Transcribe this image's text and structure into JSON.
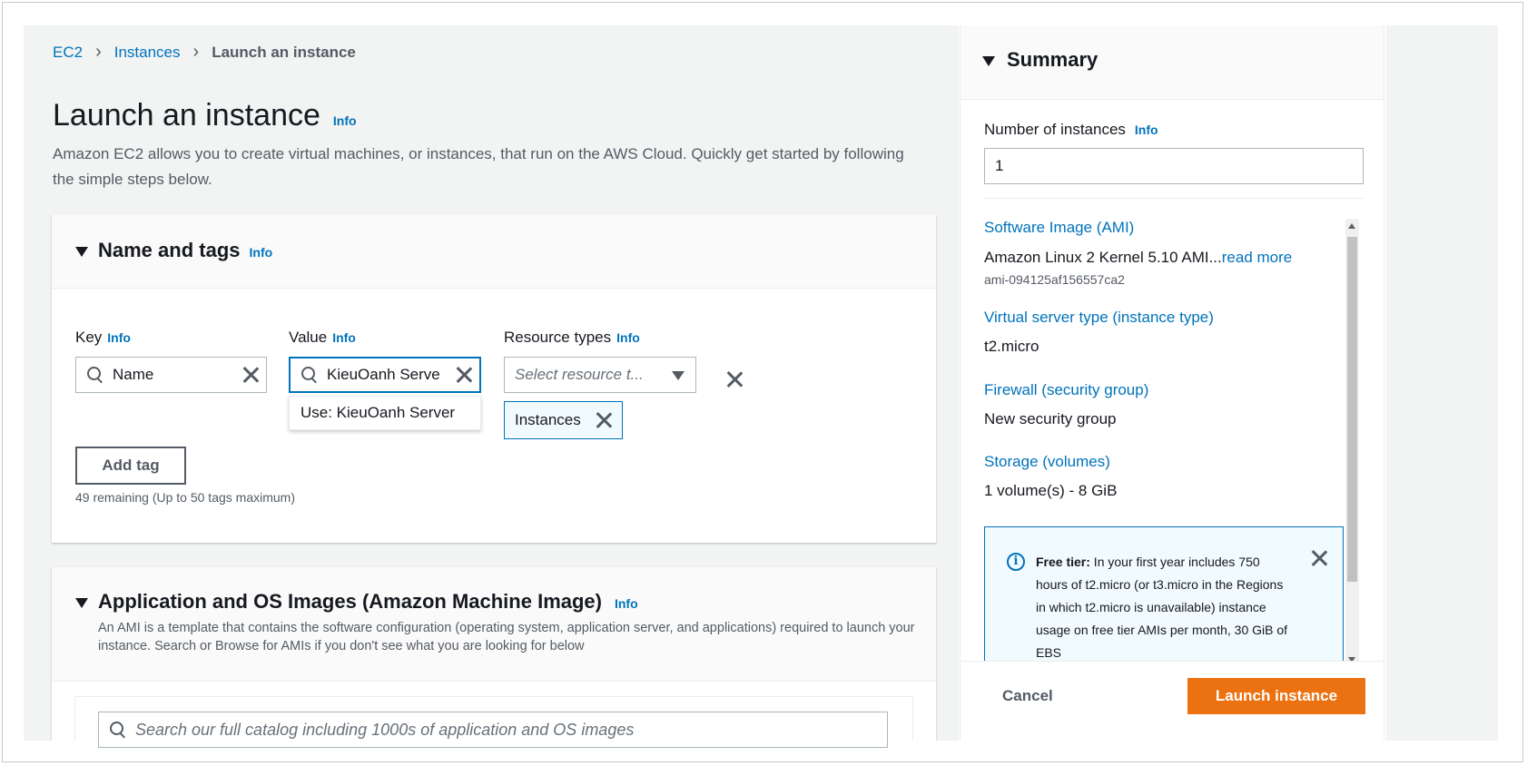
{
  "breadcrumb": {
    "items": [
      "EC2",
      "Instances"
    ],
    "current": "Launch an instance"
  },
  "page": {
    "title": "Launch an instance",
    "info": "Info",
    "description": "Amazon EC2 allows you to create virtual machines, or instances, that run on the AWS Cloud. Quickly get started by following the simple steps below."
  },
  "name_tags": {
    "title": "Name and tags",
    "info": "Info",
    "key_label": "Key",
    "value_label": "Value",
    "resource_label": "Resource types",
    "key_value": "Name",
    "value_value": "KieuOanh Serve",
    "resource_placeholder": "Select resource t...",
    "suggestion": "Use: KieuOanh Server",
    "token": "Instances",
    "add_tag": "Add tag",
    "remaining": "49 remaining (Up to 50 tags maximum)"
  },
  "ami": {
    "title": "Application and OS Images (Amazon Machine Image)",
    "info": "Info",
    "description": "An AMI is a template that contains the software configuration (operating system, application server, and applications) required to launch your instance. Search or Browse for AMIs if you don't see what you are looking for below",
    "search_placeholder": "Search our full catalog including 1000s of application and OS images"
  },
  "summary": {
    "title": "Summary",
    "num_label": "Number of instances",
    "info": "Info",
    "num_value": "1",
    "ami_link": "Software Image (AMI)",
    "ami_value": "Amazon Linux 2 Kernel 5.10 AMI...",
    "read_more": "read more",
    "ami_id": "ami-094125af156557ca2",
    "type_link": "Virtual server type (instance type)",
    "type_value": "t2.micro",
    "fw_link": "Firewall (security group)",
    "fw_value": "New security group",
    "storage_link": "Storage (volumes)",
    "storage_value": "1 volume(s) - 8 GiB",
    "free_tier_label": "Free tier:",
    "free_tier_text": " In your first year includes 750 hours of t2.micro (or t3.micro in the Regions in which t2.micro is unavailable) instance usage on free tier AMIs per month, 30 GiB of EBS",
    "cancel": "Cancel",
    "launch": "Launch instance"
  }
}
